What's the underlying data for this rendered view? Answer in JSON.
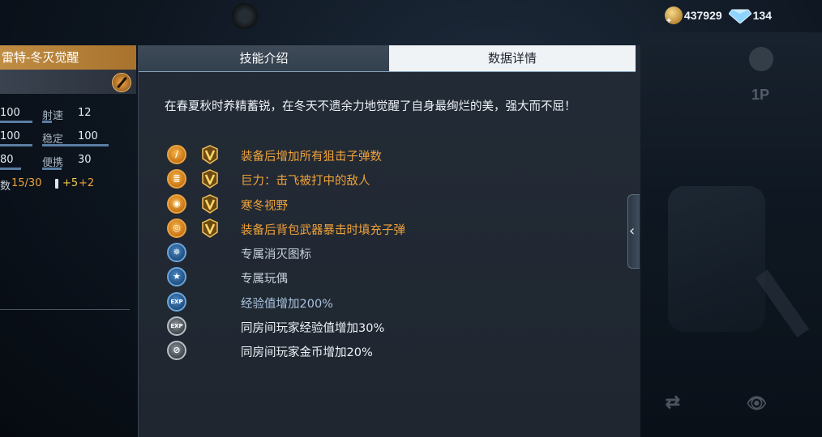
{
  "currency": {
    "coins": "437929",
    "gems": "134"
  },
  "weapon": {
    "name": "雷特-冬灭觉醒",
    "stats": [
      {
        "left_value": "100",
        "label": "射速",
        "right_value": "12"
      },
      {
        "left_value": "100",
        "label": "稳定",
        "right_value": "100"
      },
      {
        "left_value": "80",
        "label": "便携",
        "right_value": "30"
      }
    ],
    "magazine": {
      "label": "数",
      "value": "15/30",
      "bonus1": "+5",
      "bonus2": "+2"
    }
  },
  "tabs": [
    {
      "label": "技能介绍",
      "active": true
    },
    {
      "label": "数据详情",
      "active": false
    }
  ],
  "description": "在春夏秋时养精蓄锐，在冬天不遗余力地觉醒了自身最绚烂的美，强大而不屈！",
  "skills": [
    {
      "icon": "sniper-rifle-icon",
      "color": "gold",
      "v_badge": true,
      "text": "装备后增加所有狙击子弹数",
      "text_color": "orange"
    },
    {
      "icon": "knockback-icon",
      "color": "gold",
      "v_badge": true,
      "text": "巨力：击飞被打中的敌人",
      "text_color": "orange"
    },
    {
      "icon": "eye-icon",
      "color": "gold",
      "v_badge": true,
      "text": "寒冬视野",
      "text_color": "orange"
    },
    {
      "icon": "ammo-refill-icon",
      "color": "gold",
      "v_badge": true,
      "text": "装备后背包武器暴击时填充子弹",
      "text_color": "orange"
    },
    {
      "icon": "kill-emblem-icon",
      "color": "blue",
      "v_badge": false,
      "text": "专属消灭图标",
      "text_color": "steel"
    },
    {
      "icon": "star-icon",
      "color": "blue",
      "v_badge": false,
      "text": "专属玩偶",
      "text_color": "steel"
    },
    {
      "icon": "exp-icon",
      "color": "blue",
      "v_badge": false,
      "text": "经验值增加200%",
      "text_color": "blue"
    },
    {
      "icon": "room-exp-icon",
      "color": "gray",
      "v_badge": false,
      "text": "同房间玩家经验值增加30%",
      "text_color": "white"
    },
    {
      "icon": "room-coin-icon",
      "color": "gray",
      "v_badge": false,
      "text": "同房间玩家金币增加20%",
      "text_color": "white"
    }
  ],
  "side": {
    "view_mode": "1P"
  }
}
